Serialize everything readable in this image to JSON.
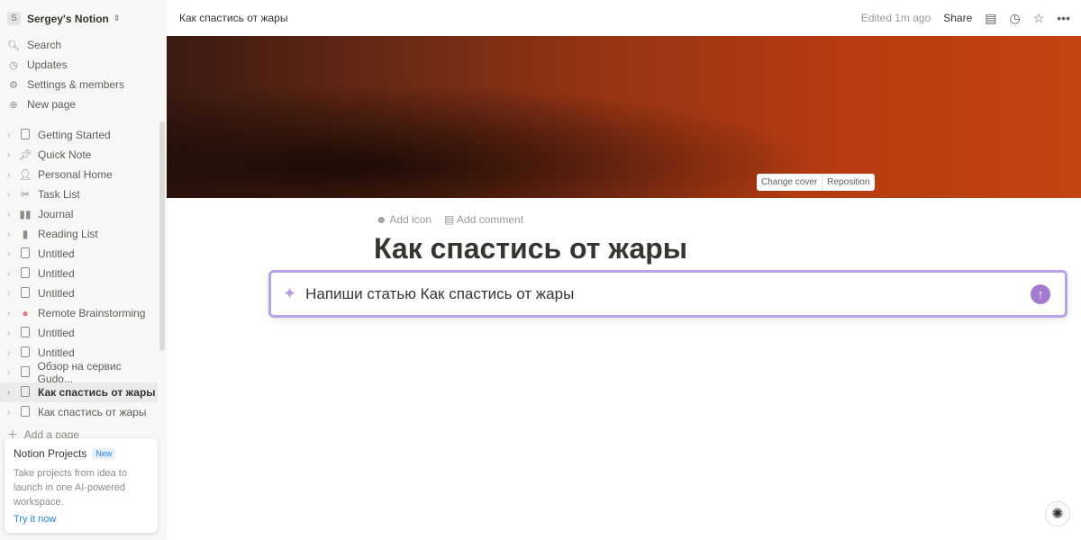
{
  "sidebar": {
    "workspace_initial": "S",
    "workspace": "Sergey's Notion",
    "nav": [
      {
        "label": "Search",
        "icon": "search-icon"
      },
      {
        "label": "Updates",
        "icon": "clock-icon"
      },
      {
        "label": "Settings & members",
        "icon": "gear-icon"
      },
      {
        "label": "New page",
        "icon": "plus-circle-icon"
      }
    ],
    "pages": [
      {
        "label": "Getting Started",
        "icon": "doc"
      },
      {
        "label": "Quick Note",
        "icon": "pin"
      },
      {
        "label": "Personal Home",
        "icon": "person"
      },
      {
        "label": "Task List",
        "icon": "scissors"
      },
      {
        "label": "Journal",
        "icon": "book"
      },
      {
        "label": "Reading List",
        "icon": "book2"
      },
      {
        "label": "Untitled",
        "icon": "doc"
      },
      {
        "label": "Untitled",
        "icon": "doc"
      },
      {
        "label": "Untitled",
        "icon": "doc"
      },
      {
        "label": "Remote Brainstorming",
        "icon": "brain"
      },
      {
        "label": "Untitled",
        "icon": "doc"
      },
      {
        "label": "Untitled",
        "icon": "doc"
      },
      {
        "label": "Обзор на сервис Gudo...",
        "icon": "doc"
      },
      {
        "label": "Как спастись от жары",
        "icon": "doc",
        "active": true
      },
      {
        "label": "Как спастись от жары",
        "icon": "doc"
      }
    ],
    "add_page": "Add a page",
    "promo": {
      "title": "Notion Projects",
      "badge": "New",
      "desc": "Take projects from idea to launch in one AI-powered workspace.",
      "link": "Try it now"
    }
  },
  "topbar": {
    "breadcrumb": "Как спастись от жары",
    "edited": "Edited 1m ago",
    "share": "Share"
  },
  "cover": {
    "change": "Change cover",
    "reposition": "Reposition"
  },
  "page": {
    "add_icon": "Add icon",
    "add_comment": "Add comment",
    "title": "Как спастись от жары"
  },
  "ai": {
    "prompt": "Напиши статью Как спастись от жары",
    "accent": "#a27bd0"
  }
}
